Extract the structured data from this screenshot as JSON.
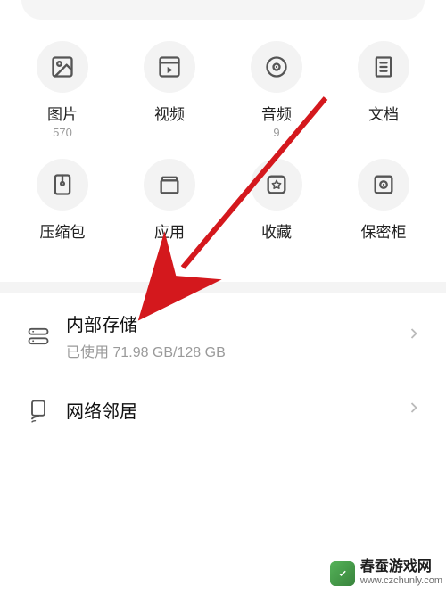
{
  "search": {
    "placeholder": ""
  },
  "categories": [
    {
      "id": "pictures",
      "label": "图片",
      "count": "570",
      "icon": "image-icon"
    },
    {
      "id": "videos",
      "label": "视频",
      "count": "",
      "icon": "video-icon"
    },
    {
      "id": "audio",
      "label": "音频",
      "count": "9",
      "icon": "audio-icon"
    },
    {
      "id": "docs",
      "label": "文档",
      "count": "",
      "icon": "document-icon"
    },
    {
      "id": "archive",
      "label": "压缩包",
      "count": "",
      "icon": "archive-icon"
    },
    {
      "id": "apps",
      "label": "应用",
      "count": "",
      "icon": "apps-icon"
    },
    {
      "id": "favorite",
      "label": "收藏",
      "count": "",
      "icon": "favorite-icon"
    },
    {
      "id": "safe",
      "label": "保密柜",
      "count": "",
      "icon": "safe-icon"
    }
  ],
  "storage": {
    "title": "内部存储",
    "used_label": "已使用 71.98 GB/128 GB"
  },
  "network": {
    "title": "网络邻居"
  },
  "watermark": {
    "name": "春蚕游戏网",
    "url": "www.czchunly.com"
  },
  "annotation": {
    "arrow_color": "#d4181d"
  }
}
